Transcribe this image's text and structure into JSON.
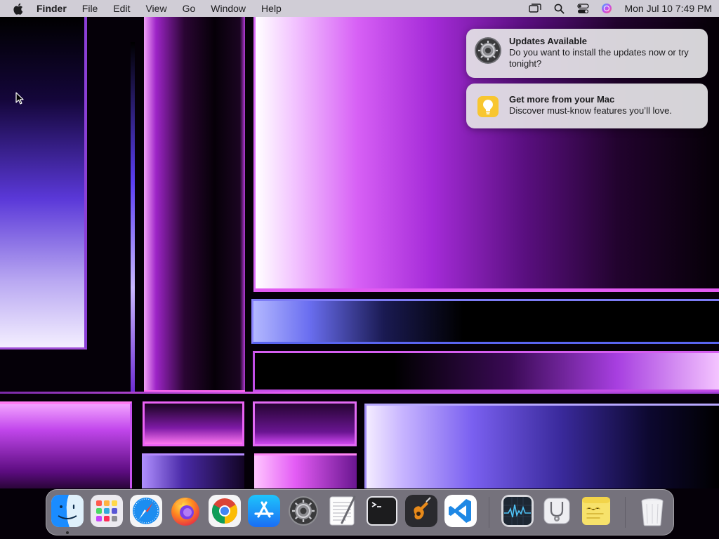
{
  "menubar": {
    "app_name": "Finder",
    "menus": [
      "File",
      "Edit",
      "View",
      "Go",
      "Window",
      "Help"
    ],
    "clock": "Mon Jul 10  7:49 PM",
    "status_icons": [
      "screen-mirroring-icon",
      "spotlight-search-icon",
      "control-center-icon",
      "siri-icon"
    ]
  },
  "notifications": [
    {
      "icon": "system-settings-gear-icon",
      "title": "Updates Available",
      "body": "Do you want to install the updates now or try tonight?"
    },
    {
      "icon": "tips-lightbulb-icon",
      "title": "Get more from your Mac",
      "body": "Discover must-know features you’ll love."
    }
  ],
  "dock": {
    "apps": [
      "Finder",
      "Launchpad",
      "Safari",
      "Firefox",
      "Google Chrome",
      "App Store",
      "System Settings",
      "TextEdit",
      "Terminal",
      "GarageBand",
      "Visual Studio Code",
      "Activity Monitor",
      "Disk Utility",
      "Stickies",
      "Trash"
    ],
    "running": [
      "Finder"
    ]
  },
  "colors": {
    "menubar_bg": "#e2dee8",
    "notification_bg": "#e2e0e4",
    "dock_bg": "#d2d0dc",
    "wallpaper_accent": "#d760f5"
  }
}
